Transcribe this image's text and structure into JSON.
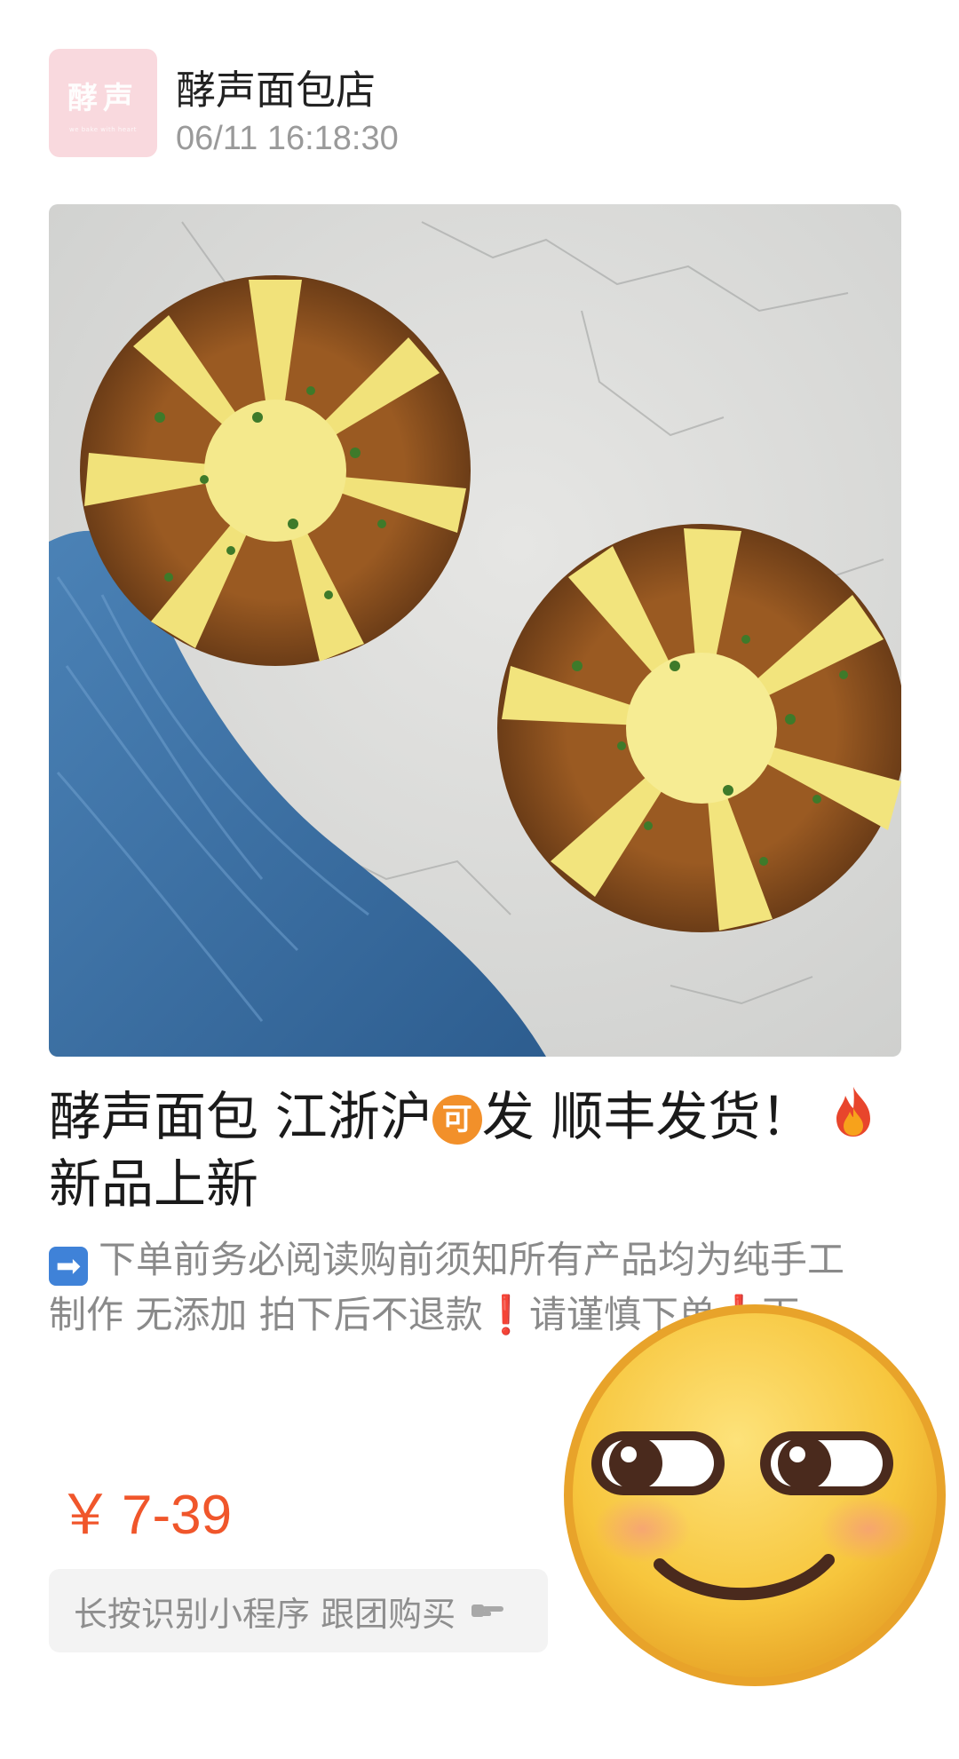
{
  "header": {
    "avatar_text": "酵声",
    "avatar_sub": "we bake with heart",
    "shop_name": "酵声面包店",
    "timestamp": "06/11 16:18:30"
  },
  "post": {
    "image_icon": "garlic-cheese-bread-photo",
    "title_line1_a": "酵声面包 江浙沪",
    "title_badge": "可",
    "title_line1_b": "发 顺丰发货！",
    "title_line2": "新品上新",
    "fire_icon": "fire-icon",
    "desc_arrow": "➡",
    "desc_line1": "下单前务必阅读购前须知所有产品均为纯手工",
    "desc_line2_a": "制作 无添加    拍下后不退款",
    "desc_excl1": "❗",
    "desc_line2_b": "请谨慎下单",
    "desc_excl2": "❗",
    "desc_line2_c": "下…"
  },
  "price": {
    "currency": "￥",
    "range": "7-39",
    "color": "#f0562b"
  },
  "mini_program": {
    "label": "长按识别小程序 跟团购买",
    "icon": "pointing-hand-icon"
  },
  "overlay": {
    "emoji": "smirk-emoji"
  }
}
